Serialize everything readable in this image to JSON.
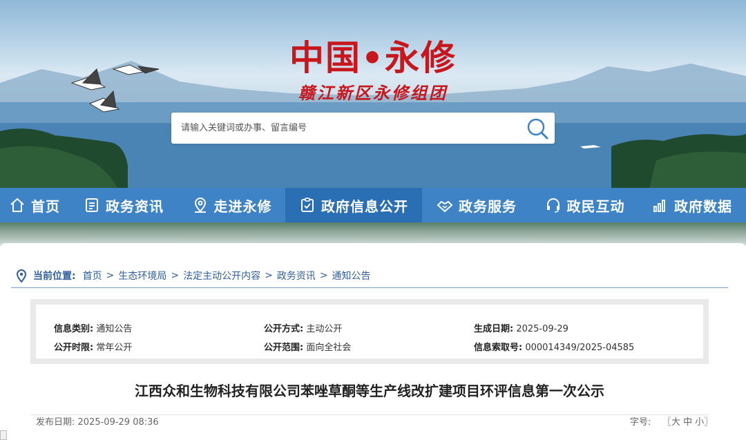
{
  "site": {
    "title": "中国•永修",
    "subtitle": "赣江新区永修组团"
  },
  "search": {
    "placeholder": "请输入关键词或办事、留言编号",
    "icon": "search-icon"
  },
  "nav": {
    "items": [
      {
        "label": "首页",
        "icon": "home-icon"
      },
      {
        "label": "政务资讯",
        "icon": "news-icon"
      },
      {
        "label": "走进永修",
        "icon": "location-icon"
      },
      {
        "label": "政府信息公开",
        "icon": "clipboard-check-icon",
        "active": true
      },
      {
        "label": "政务服务",
        "icon": "handshake-icon"
      },
      {
        "label": "政民互动",
        "icon": "headset-icon"
      },
      {
        "label": "政府数据",
        "icon": "bar-chart-icon"
      }
    ]
  },
  "breadcrumb": {
    "label": "当前位置:",
    "items": [
      "首页",
      "生态环境局",
      "法定主动公开内容",
      "政务资讯",
      "通知公告"
    ],
    "separator": ">"
  },
  "meta": {
    "category_label": "信息类别:",
    "category_value": "通知公告",
    "method_label": "公开方式:",
    "method_value": "主动公开",
    "created_label": "生成日期:",
    "created_value": "2025-09-29",
    "period_label": "公开时限:",
    "period_value": "常年公开",
    "scope_label": "公开范围:",
    "scope_value": "面向全社会",
    "index_label": "信息索取号:",
    "index_value": "000014349/2025-04585"
  },
  "article": {
    "title": "江西众和生物科技有限公司苯唑草酮等生产线改扩建项目环评信息第一次公示",
    "publish_label": "发布日期:",
    "publish_value": "2025-09-29 08:36",
    "fontsize_label": "字号:",
    "fontsize_open": "〖",
    "fontsize_large": "大",
    "fontsize_medium": "中",
    "fontsize_small": "小",
    "fontsize_close": "〗"
  },
  "colors": {
    "nav_bg": "#3d83c6",
    "nav_active": "#2a6fb3",
    "title_red": "#c8161d",
    "breadcrumb_blue": "#2f5f9e"
  }
}
